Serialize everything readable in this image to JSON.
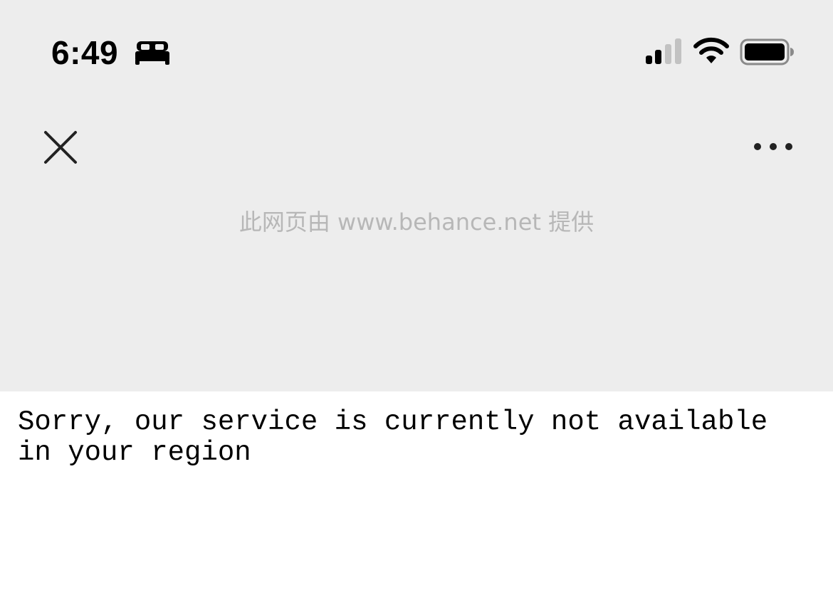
{
  "status_bar": {
    "time": "6:49",
    "focus_icon": "bed-icon",
    "signal_icon": "cellular-signal-icon",
    "wifi_icon": "wifi-icon",
    "battery_icon": "battery-icon"
  },
  "header": {
    "close_icon": "close-icon",
    "more_icon": "more-options-icon",
    "provider_note": "此网页由 www.behance.net 提供"
  },
  "page": {
    "message": "Sorry, our service is currently not available in your region"
  },
  "colors": {
    "top_background": "#ededed",
    "page_background": "#ffffff",
    "provider_text": "#b7b7b7",
    "icon_dark": "#222222"
  }
}
